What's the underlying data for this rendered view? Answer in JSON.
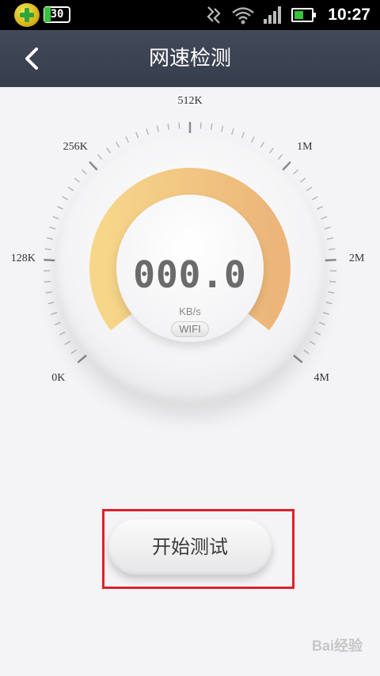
{
  "status_bar": {
    "badge_text": "30",
    "time": "10:27",
    "icons": [
      "app-360-icon",
      "network-activity-icon",
      "wifi-icon",
      "signal-icon",
      "battery-icon"
    ],
    "battery_level": 0.55
  },
  "header": {
    "title": "网速检测",
    "back_icon": "chevron-left-icon"
  },
  "gauge": {
    "scale_labels": [
      "0K",
      "128K",
      "256K",
      "512K",
      "1M",
      "2M",
      "4M"
    ],
    "value": "000.0",
    "unit": "KB/s",
    "network": "WIFI",
    "arc_colors": [
      "#f6d689",
      "#ecb57a"
    ]
  },
  "actions": {
    "start_label": "开始测试"
  },
  "watermark": "Bai经验"
}
